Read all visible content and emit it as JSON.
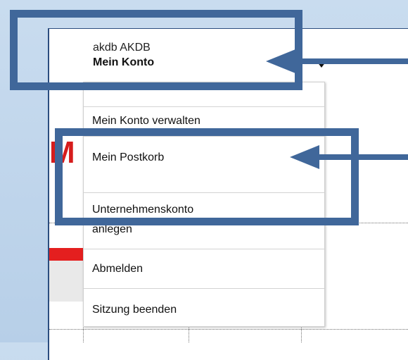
{
  "account": {
    "user": "akdb AKDB",
    "title": "Mein Konto"
  },
  "menu": {
    "items": [
      "Mein Konto verwalten",
      "Mein Postkorb",
      "Unternehmenskonto",
      "anlegen",
      "Abmelden",
      "Sitzung beenden"
    ]
  },
  "background": {
    "logo_letter": "M"
  },
  "colors": {
    "annotation": "#40679a",
    "brand_red": "#e41f1f"
  }
}
